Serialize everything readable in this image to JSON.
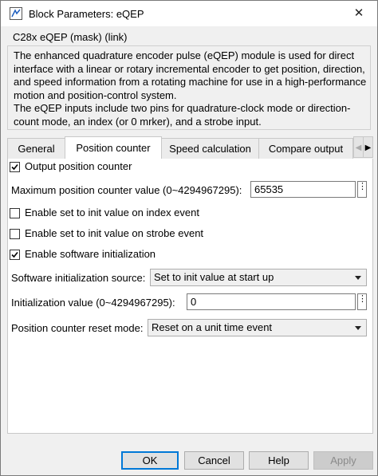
{
  "window": {
    "title": "Block Parameters: eQEP",
    "close_glyph": "✕"
  },
  "mask": {
    "title": "C28x eQEP (mask) (link)",
    "description": "The enhanced quadrature encoder pulse (eQEP) module is used for direct interface with a linear or rotary incremental encoder to get position, direction, and speed information from a rotating machine for use in a high-performance motion and position-control system.\nThe eQEP inputs include two pins for quadrature-clock mode or direction-count mode, an index (or 0 mrker), and a strobe input."
  },
  "tabs": [
    {
      "label": "General",
      "active": false
    },
    {
      "label": "Position counter",
      "active": true
    },
    {
      "label": "Speed calculation",
      "active": false
    },
    {
      "label": "Compare output",
      "active": false
    }
  ],
  "tab_scroll": {
    "left": "◀",
    "right": "▶"
  },
  "params": {
    "output_position_counter": {
      "label": "Output position counter",
      "checked": true
    },
    "max_position": {
      "label": "Maximum position counter value (0~4294967295):",
      "value": "65535",
      "more": "⋮"
    },
    "init_on_index": {
      "label": "Enable set to init value on index event",
      "checked": false
    },
    "init_on_strobe": {
      "label": "Enable set to init value on strobe event",
      "checked": false
    },
    "software_init": {
      "label": "Enable software initialization",
      "checked": true
    },
    "init_source": {
      "label": "Software initialization source:",
      "value": "Set to init value at start up"
    },
    "init_value": {
      "label": "Initialization value (0~4294967295):",
      "value": "0",
      "more": "⋮"
    },
    "reset_mode": {
      "label": "Position counter reset mode:",
      "value": "Reset on a unit time event"
    }
  },
  "buttons": {
    "ok": "OK",
    "cancel": "Cancel",
    "help": "Help",
    "apply": "Apply"
  },
  "colors": {
    "window_bg": "#f0f0f0",
    "panel_bg": "#ffffff",
    "accent": "#0078d7"
  }
}
